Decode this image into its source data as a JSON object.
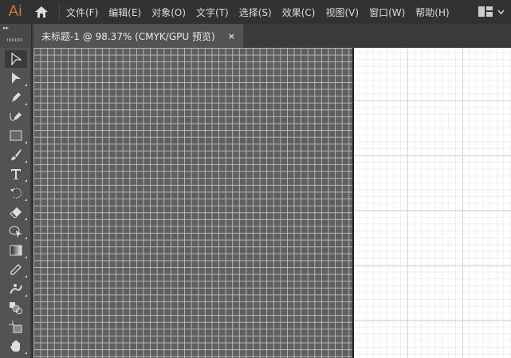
{
  "app": {
    "logo": "Ai"
  },
  "menu": [
    "文件(F)",
    "编辑(E)",
    "对象(O)",
    "文字(T)",
    "选择(S)",
    "效果(C)",
    "视图(V)",
    "窗口(W)",
    "帮助(H)"
  ],
  "document_tab": {
    "title": "未标题-1 @ 98.37% (CMYK/GPU 预览)",
    "close": "×"
  },
  "panel": {
    "collapse": "▸▸"
  },
  "tools": [
    "selection",
    "direct-selection",
    "pen",
    "curvature",
    "rectangle",
    "paintbrush",
    "type",
    "rotate",
    "eraser",
    "shape-builder",
    "gradient",
    "eyedropper",
    "puppet-warp",
    "blend",
    "artboard",
    "hand"
  ]
}
